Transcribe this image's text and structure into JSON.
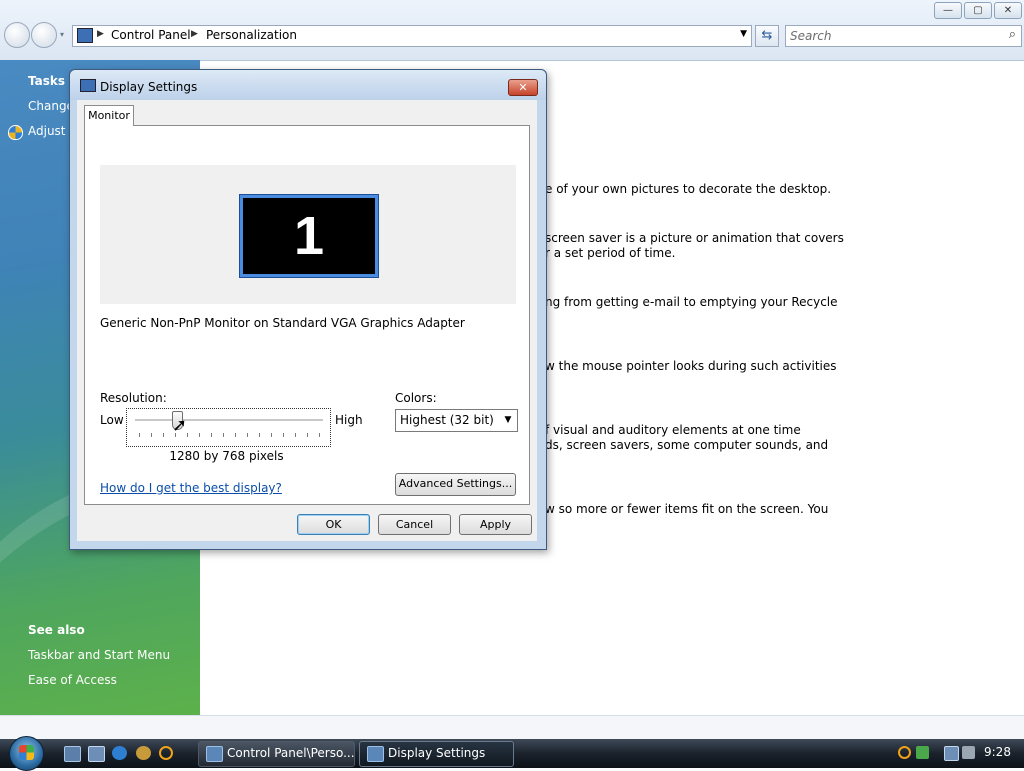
{
  "window": {
    "caption_buttons": {
      "minimize": "—",
      "maximize": "▢",
      "close": "✕"
    },
    "breadcrumb": [
      "Control Panel",
      "Personalization"
    ],
    "search_placeholder": "Search"
  },
  "left_pane": {
    "tasks_heading": "Tasks",
    "tasks": [
      "Change",
      "Adjust f"
    ],
    "see_also_heading": "See also",
    "see_also": [
      "Taskbar and Start Menu",
      "Ease of Access"
    ]
  },
  "background_text": [
    "e of your own pictures to decorate the desktop.",
    "screen saver is a picture or animation that covers",
    "r a set period of time.",
    "ng from getting e-mail to emptying your Recycle",
    "w the mouse pointer looks during such activities",
    "f visual and auditory elements at one time",
    "ds, screen savers, some computer sounds, and",
    "w so more or fewer items fit on the screen. You"
  ],
  "dialog": {
    "title": "Display Settings",
    "close_glyph": "✕",
    "tab_label": "Monitor",
    "monitor_number": "1",
    "monitor_name": "Generic Non-PnP Monitor on Standard VGA Graphics Adapter",
    "resolution_label": "Resolution:",
    "slider_low": "Low",
    "slider_high": "High",
    "resolution_value": "1280 by 768 pixels",
    "colors_label": "Colors:",
    "colors_value": "Highest (32 bit)",
    "help_link": "How do I get the best display?",
    "advanced_button": "Advanced Settings...",
    "ok_button": "OK",
    "cancel_button": "Cancel",
    "apply_button": "Apply"
  },
  "taskbar": {
    "buttons": [
      "Control Panel\\Perso...",
      "Display Settings"
    ],
    "clock": "9:28"
  },
  "colors": {
    "dialog_frame": "#c2d6ec",
    "monitor_border": "#4a8ce0",
    "link": "#0a4ea8",
    "close_red": "#c7432a"
  }
}
